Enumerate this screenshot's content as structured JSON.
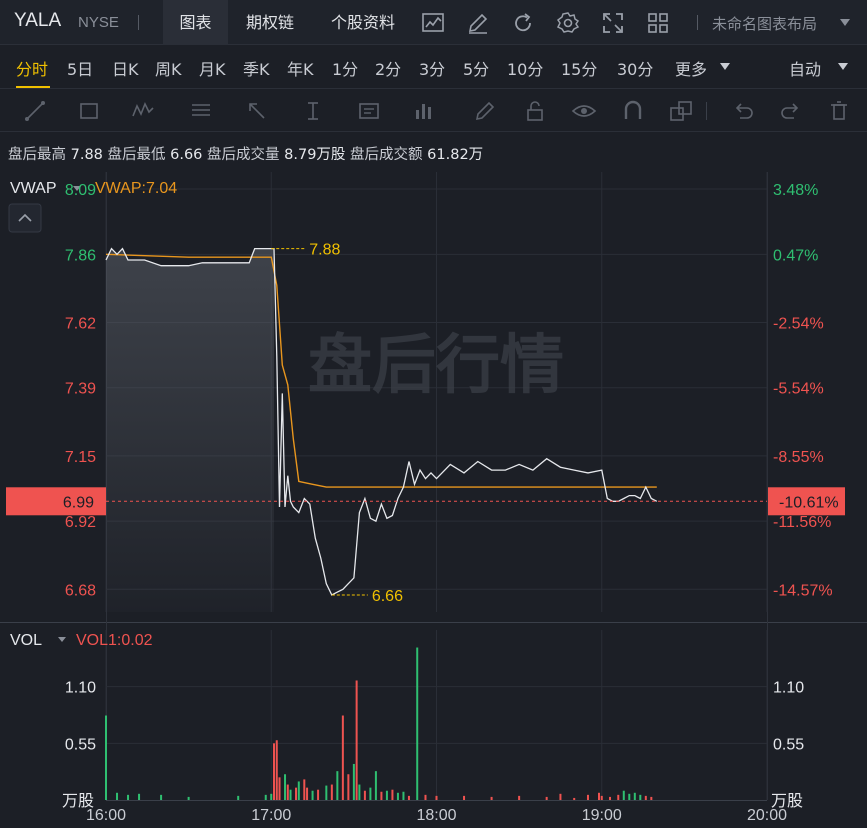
{
  "header": {
    "ticker": "YALA",
    "exchange": "NYSE",
    "tabs": [
      {
        "label": "图表",
        "active": true
      },
      {
        "label": "期权链",
        "active": false
      },
      {
        "label": "个股资料",
        "active": false
      }
    ],
    "layout_name": "未命名图表布局"
  },
  "periods": {
    "items": [
      "分时",
      "5日",
      "日K",
      "周K",
      "月K",
      "季K",
      "年K",
      "1分",
      "2分",
      "3分",
      "5分",
      "10分",
      "15分",
      "30分",
      "更多"
    ],
    "active": "分时",
    "scale_mode": "自动"
  },
  "info": {
    "high_label": "盘后最高",
    "high_value": "7.88",
    "low_label": "盘后最低",
    "low_value": "6.66",
    "vol_label": "盘后成交量",
    "vol_value": "8.79万股",
    "amt_label": "盘后成交额",
    "amt_value": "61.82万"
  },
  "main_panel": {
    "indicator": "VWAP",
    "indicator_value": "VWAP:7.04",
    "watermark": "盘后行情",
    "price_labels": [
      "8.09",
      "7.86",
      "7.62",
      "7.39",
      "7.15",
      "6.92",
      "6.68"
    ],
    "pct_labels": [
      "3.48%",
      "0.47%",
      "-2.54%",
      "-5.54%",
      "-8.55%",
      "-11.56%",
      "-14.57%"
    ],
    "current_price": "6.99",
    "current_pct": "-10.61%",
    "high_marker": "7.88",
    "low_marker": "6.66"
  },
  "vol_panel": {
    "indicator": "VOL",
    "indicator_value": "VOL1:0.02",
    "labels": [
      "1.10",
      "0.55"
    ],
    "unit": "万股"
  },
  "x_axis": [
    "16:00",
    "17:00",
    "18:00",
    "19:00",
    "20:00"
  ],
  "colors": {
    "up": "#2fbf71",
    "down": "#ef5350",
    "vwap": "#e8961e",
    "accent": "#f0c000",
    "price_line": "#e6e8ec"
  },
  "chart_data": {
    "type": "line",
    "title": "",
    "xlabel": "",
    "ylabel": "",
    "x_range": [
      "16:00",
      "20:00"
    ],
    "ylim": [
      6.6,
      8.15
    ],
    "series": [
      {
        "name": "",
        "x": [
          "16:00",
          "16:02",
          "16:04",
          "16:06",
          "16:08",
          "16:10",
          "16:14",
          "16:20",
          "16:25",
          "16:30",
          "16:35",
          "16:40",
          "16:45",
          "16:50",
          "16:52",
          "16:54",
          "16:56",
          "16:58",
          "17:00",
          "17:01",
          "17:02",
          "17:03",
          "17:04",
          "17:05",
          "17:06",
          "17:07",
          "17:08",
          "17:10",
          "17:12",
          "17:14",
          "17:16",
          "17:18",
          "17:20",
          "17:22",
          "17:24",
          "17:26",
          "17:28",
          "17:30",
          "17:32",
          "17:34",
          "17:36",
          "17:38",
          "17:40",
          "17:42",
          "17:44",
          "17:46",
          "17:48",
          "17:50",
          "17:52",
          "17:54",
          "17:56",
          "17:58",
          "18:00",
          "18:05",
          "18:10",
          "18:15",
          "18:20",
          "18:25",
          "18:30",
          "18:35",
          "18:40",
          "18:45",
          "18:50",
          "18:55",
          "19:00",
          "19:02",
          "19:04",
          "19:06",
          "19:08",
          "19:10",
          "19:12",
          "19:14",
          "19:16",
          "19:18",
          "19:20"
        ],
        "values": [
          7.84,
          7.88,
          7.86,
          7.88,
          7.84,
          7.84,
          7.84,
          7.82,
          7.82,
          7.82,
          7.83,
          7.83,
          7.83,
          7.83,
          7.83,
          7.88,
          7.88,
          7.88,
          7.88,
          7.88,
          7.5,
          6.97,
          7.37,
          6.97,
          7.08,
          6.99,
          6.97,
          6.95,
          7.0,
          6.98,
          6.86,
          6.79,
          6.7,
          6.66,
          6.67,
          6.68,
          6.7,
          6.72,
          6.95,
          7.0,
          6.93,
          6.92,
          6.98,
          6.93,
          6.94,
          7.0,
          7.04,
          7.13,
          7.05,
          7.1,
          7.07,
          7.09,
          7.07,
          7.12,
          7.09,
          7.13,
          7.1,
          7.1,
          7.12,
          7.1,
          7.14,
          7.11,
          7.1,
          7.09,
          7.1,
          7.0,
          6.99,
          6.99,
          7.0,
          7.01,
          7.01,
          7.0,
          7.04,
          7.0,
          6.99
        ]
      },
      {
        "name": "VWAP",
        "x": [
          "16:00",
          "16:30",
          "17:00",
          "17:02",
          "17:04",
          "17:06",
          "17:08",
          "17:10",
          "17:15",
          "17:20",
          "17:30",
          "17:40",
          "17:50",
          "18:00",
          "18:30",
          "19:00",
          "19:30"
        ],
        "values": [
          7.86,
          7.85,
          7.85,
          7.75,
          7.47,
          7.4,
          7.21,
          7.06,
          7.05,
          7.04,
          7.04,
          7.04,
          7.04,
          7.04,
          7.04,
          7.04,
          7.04
        ]
      }
    ],
    "volume_unit": "万股",
    "volume_ylim": [
      0,
      1.65
    ],
    "volume_bars": [
      {
        "t": "16:00",
        "v": 0.82,
        "dir": "up"
      },
      {
        "t": "16:04",
        "v": 0.07,
        "dir": "up"
      },
      {
        "t": "16:08",
        "v": 0.05,
        "dir": "up"
      },
      {
        "t": "16:12",
        "v": 0.06,
        "dir": "up"
      },
      {
        "t": "16:20",
        "v": 0.05,
        "dir": "up"
      },
      {
        "t": "16:30",
        "v": 0.03,
        "dir": "up"
      },
      {
        "t": "16:48",
        "v": 0.04,
        "dir": "up"
      },
      {
        "t": "16:58",
        "v": 0.05,
        "dir": "up"
      },
      {
        "t": "17:00",
        "v": 0.06,
        "dir": "up"
      },
      {
        "t": "17:01",
        "v": 0.55,
        "dir": "down"
      },
      {
        "t": "17:02",
        "v": 0.58,
        "dir": "down"
      },
      {
        "t": "17:03",
        "v": 0.22,
        "dir": "down"
      },
      {
        "t": "17:05",
        "v": 0.25,
        "dir": "up"
      },
      {
        "t": "17:06",
        "v": 0.15,
        "dir": "down"
      },
      {
        "t": "17:07",
        "v": 0.1,
        "dir": "up"
      },
      {
        "t": "17:09",
        "v": 0.12,
        "dir": "down"
      },
      {
        "t": "17:10",
        "v": 0.18,
        "dir": "up"
      },
      {
        "t": "17:12",
        "v": 0.2,
        "dir": "down"
      },
      {
        "t": "17:13",
        "v": 0.12,
        "dir": "down"
      },
      {
        "t": "17:15",
        "v": 0.09,
        "dir": "up"
      },
      {
        "t": "17:17",
        "v": 0.1,
        "dir": "down"
      },
      {
        "t": "17:20",
        "v": 0.14,
        "dir": "up"
      },
      {
        "t": "17:22",
        "v": 0.15,
        "dir": "down"
      },
      {
        "t": "17:24",
        "v": 0.28,
        "dir": "up"
      },
      {
        "t": "17:26",
        "v": 0.82,
        "dir": "down"
      },
      {
        "t": "17:28",
        "v": 0.25,
        "dir": "down"
      },
      {
        "t": "17:30",
        "v": 0.35,
        "dir": "up"
      },
      {
        "t": "17:31",
        "v": 1.16,
        "dir": "down"
      },
      {
        "t": "17:32",
        "v": 0.15,
        "dir": "up"
      },
      {
        "t": "17:34",
        "v": 0.09,
        "dir": "down"
      },
      {
        "t": "17:36",
        "v": 0.12,
        "dir": "up"
      },
      {
        "t": "17:38",
        "v": 0.28,
        "dir": "up"
      },
      {
        "t": "17:40",
        "v": 0.08,
        "dir": "down"
      },
      {
        "t": "17:42",
        "v": 0.09,
        "dir": "up"
      },
      {
        "t": "17:44",
        "v": 0.1,
        "dir": "down"
      },
      {
        "t": "17:46",
        "v": 0.07,
        "dir": "up"
      },
      {
        "t": "17:48",
        "v": 0.08,
        "dir": "up"
      },
      {
        "t": "17:50",
        "v": 0.04,
        "dir": "down"
      },
      {
        "t": "17:53",
        "v": 1.48,
        "dir": "up"
      },
      {
        "t": "17:56",
        "v": 0.05,
        "dir": "down"
      },
      {
        "t": "18:00",
        "v": 0.04,
        "dir": "down"
      },
      {
        "t": "18:10",
        "v": 0.04,
        "dir": "down"
      },
      {
        "t": "18:20",
        "v": 0.03,
        "dir": "down"
      },
      {
        "t": "18:30",
        "v": 0.04,
        "dir": "down"
      },
      {
        "t": "18:40",
        "v": 0.03,
        "dir": "down"
      },
      {
        "t": "18:45",
        "v": 0.06,
        "dir": "down"
      },
      {
        "t": "18:50",
        "v": 0.02,
        "dir": "down"
      },
      {
        "t": "18:55",
        "v": 0.05,
        "dir": "down"
      },
      {
        "t": "18:59",
        "v": 0.07,
        "dir": "down"
      },
      {
        "t": "19:00",
        "v": 0.04,
        "dir": "down"
      },
      {
        "t": "19:03",
        "v": 0.03,
        "dir": "down"
      },
      {
        "t": "19:06",
        "v": 0.05,
        "dir": "down"
      },
      {
        "t": "19:08",
        "v": 0.09,
        "dir": "up"
      },
      {
        "t": "19:10",
        "v": 0.06,
        "dir": "up"
      },
      {
        "t": "19:12",
        "v": 0.07,
        "dir": "up"
      },
      {
        "t": "19:14",
        "v": 0.05,
        "dir": "up"
      },
      {
        "t": "19:16",
        "v": 0.04,
        "dir": "down"
      },
      {
        "t": "19:18",
        "v": 0.03,
        "dir": "down"
      }
    ]
  }
}
